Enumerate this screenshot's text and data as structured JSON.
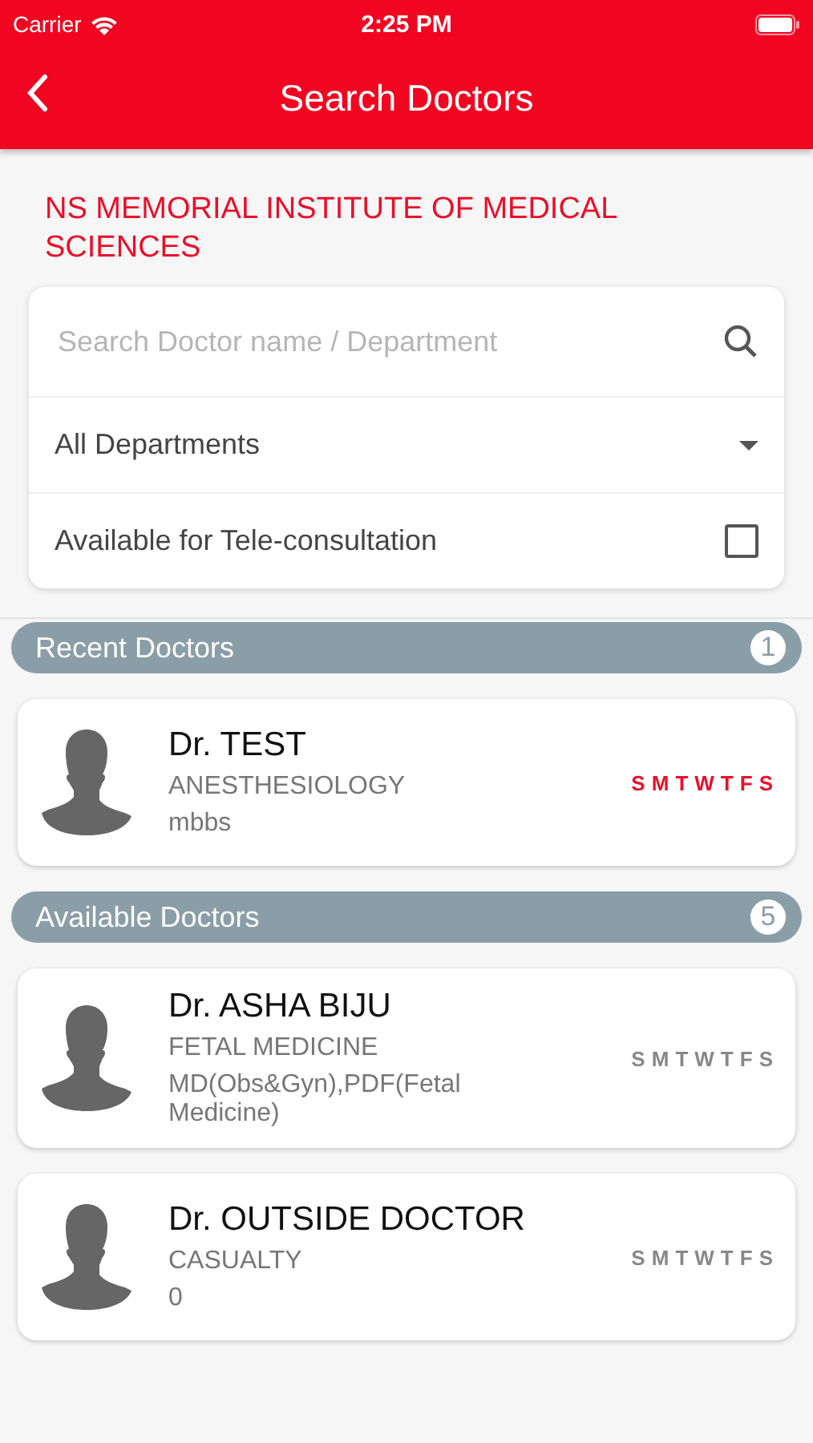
{
  "status_bar": {
    "carrier": "Carrier",
    "time": "2:25 PM"
  },
  "header": {
    "title": "Search Doctors"
  },
  "hospital": "NS MEMORIAL INSTITUTE OF MEDICAL SCIENCES",
  "search": {
    "placeholder": "Search Doctor name / Department"
  },
  "department": {
    "value": "All Departments"
  },
  "teleconsult": {
    "label": "Available for Tele-consultation",
    "checked": false
  },
  "sections": [
    {
      "title": "Recent Doctors",
      "count": "1",
      "doctors": [
        {
          "name": "Dr. TEST",
          "department": "ANESTHESIOLOGY",
          "qualification": "mbbs",
          "days": [
            {
              "label": "S",
              "active": true
            },
            {
              "label": "M",
              "active": true
            },
            {
              "label": "T",
              "active": true
            },
            {
              "label": "W",
              "active": true
            },
            {
              "label": "T",
              "active": true
            },
            {
              "label": "F",
              "active": true
            },
            {
              "label": "S",
              "active": true
            }
          ]
        }
      ]
    },
    {
      "title": "Available Doctors",
      "count": "5",
      "doctors": [
        {
          "name": "Dr. ASHA BIJU",
          "department": "FETAL MEDICINE",
          "qualification": "MD(Obs&Gyn),PDF(Fetal Medicine)",
          "days": [
            {
              "label": "S",
              "active": false
            },
            {
              "label": "M",
              "active": false
            },
            {
              "label": "T",
              "active": false
            },
            {
              "label": "W",
              "active": false
            },
            {
              "label": "T",
              "active": false
            },
            {
              "label": "F",
              "active": false
            },
            {
              "label": "S",
              "active": false
            }
          ]
        },
        {
          "name": "Dr. OUTSIDE DOCTOR",
          "department": "CASUALTY",
          "qualification": "0",
          "days": [
            {
              "label": "S",
              "active": false
            },
            {
              "label": "M",
              "active": false
            },
            {
              "label": "T",
              "active": false
            },
            {
              "label": "W",
              "active": false
            },
            {
              "label": "T",
              "active": false
            },
            {
              "label": "F",
              "active": false
            },
            {
              "label": "S",
              "active": false
            }
          ]
        }
      ]
    }
  ]
}
